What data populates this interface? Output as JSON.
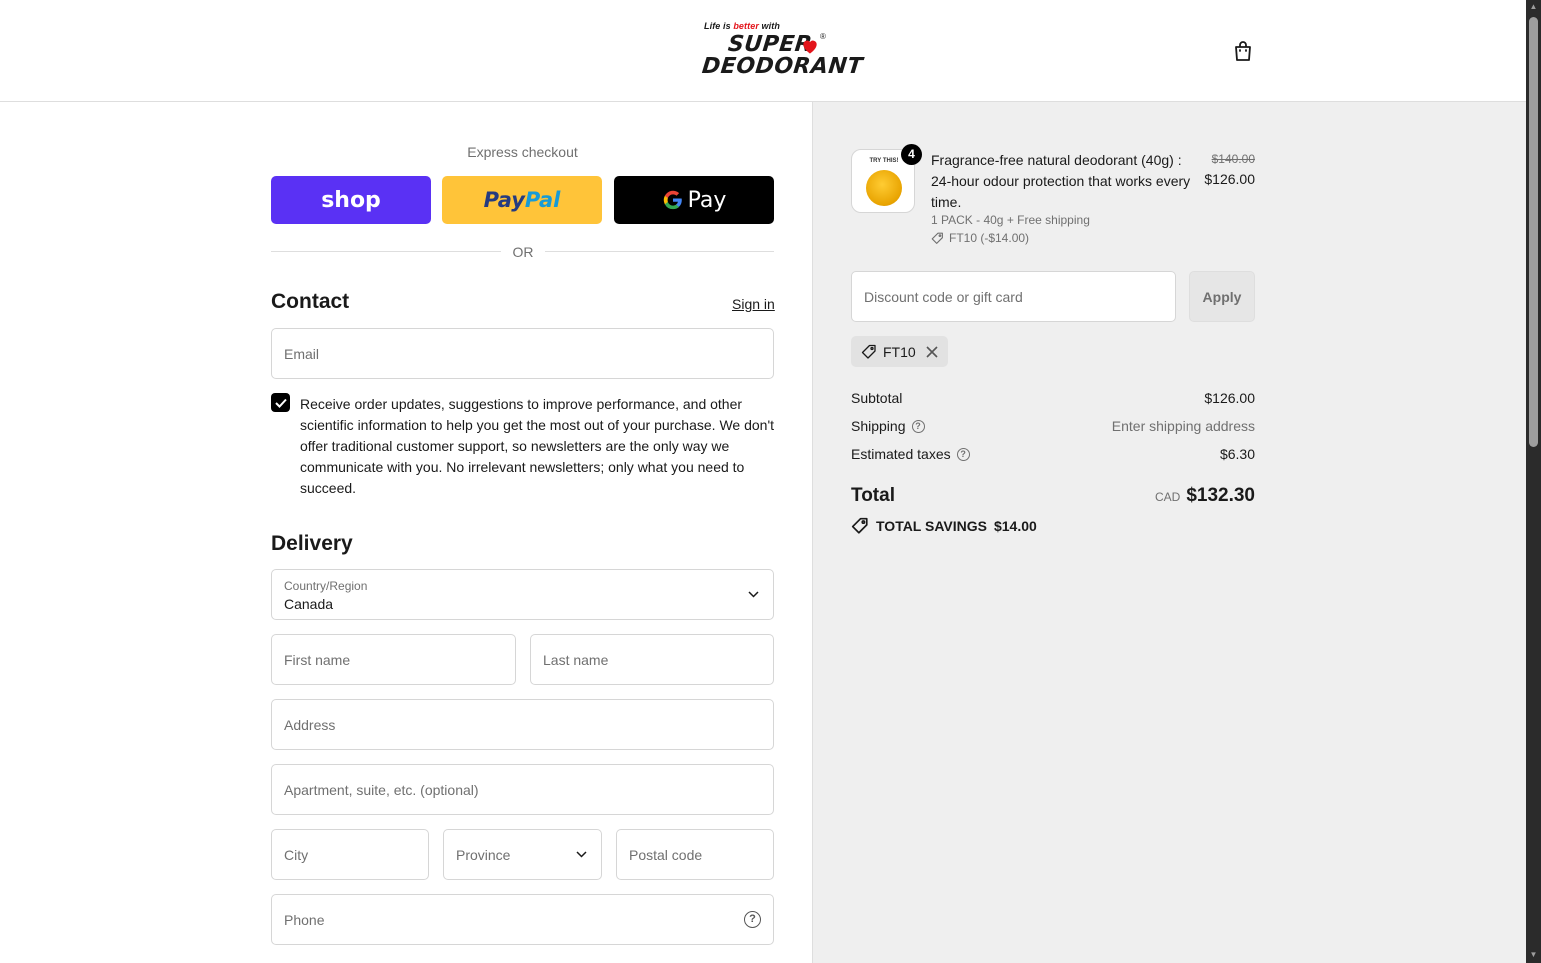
{
  "brand": {
    "tagline_pre": "Life is ",
    "tagline_accent": "better",
    "tagline_post": " with",
    "line1": "SUPER",
    "line2": "DEODORANT",
    "registered": "®"
  },
  "express": {
    "label": "Express checkout",
    "shop_label": "shop",
    "paypal_part1": "Pay",
    "paypal_part2": "Pal",
    "gpay_g": "G",
    "gpay_label": "Pay",
    "or_label": "OR"
  },
  "contact": {
    "heading": "Contact",
    "signin_label": "Sign in",
    "email_placeholder": "Email",
    "consent_checked": true,
    "consent_text": "Receive order updates, suggestions to improve performance, and other scientific information to help you get the most out of your purchase. We don't offer traditional customer support, so newsletters are the only way we communicate with you. No irrelevant newsletters; only what you need to succeed."
  },
  "delivery": {
    "heading": "Delivery",
    "country_label": "Country/Region",
    "country_value": "Canada",
    "first_name_placeholder": "First name",
    "last_name_placeholder": "Last name",
    "address_placeholder": "Address",
    "apartment_placeholder": "Apartment, suite, etc. (optional)",
    "city_placeholder": "City",
    "province_placeholder": "Province",
    "postal_placeholder": "Postal code",
    "phone_placeholder": "Phone"
  },
  "summary": {
    "product": {
      "quantity": "4",
      "thumb_text": "TRY THIS!",
      "title": "Fragrance-free natural deodorant (40g) : 24-hour odour protection that works every time.",
      "variant": "1 PACK - 40g + Free shipping",
      "discount": "FT10 (-$14.00)",
      "original_price": "$140.00",
      "price": "$126.00"
    },
    "discount_placeholder": "Discount code or gift card",
    "apply_label": "Apply",
    "applied_code": "FT10",
    "subtotal_label": "Subtotal",
    "subtotal_value": "$126.00",
    "shipping_label": "Shipping",
    "shipping_value": "Enter shipping address",
    "taxes_label": "Estimated taxes",
    "taxes_value": "$6.30",
    "total_label": "Total",
    "currency": "CAD",
    "total_value": "$132.30",
    "savings_label": "TOTAL SAVINGS",
    "savings_value": "$14.00"
  },
  "colors": {
    "shop_purple": "#5a31f4",
    "paypal_yellow": "#ffc439",
    "summary_bg": "#efefef",
    "heart_red": "#e3141b"
  }
}
